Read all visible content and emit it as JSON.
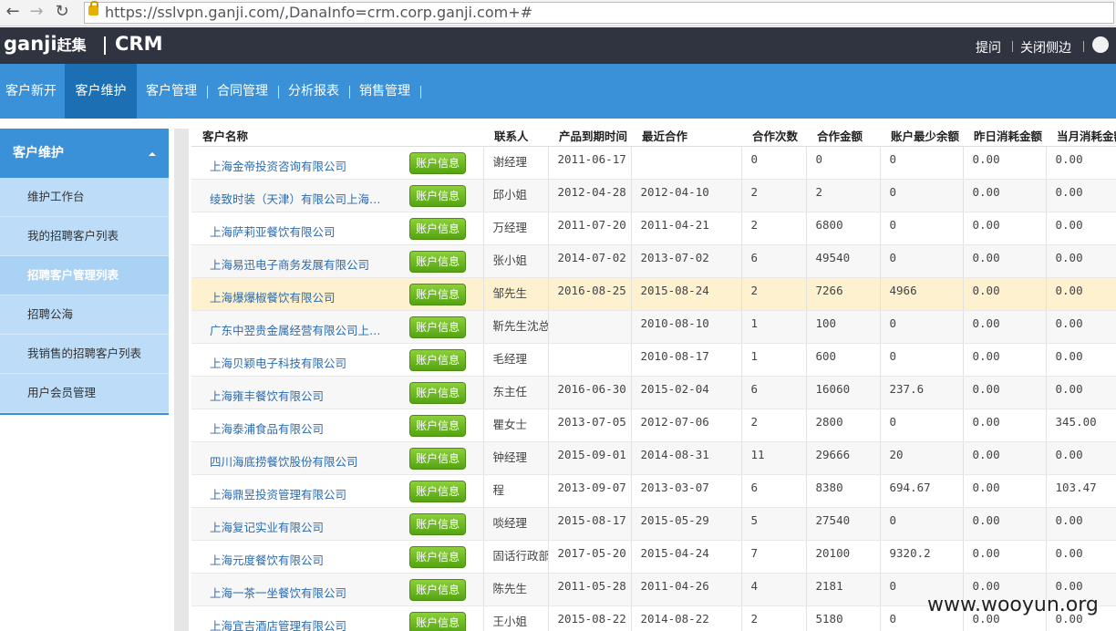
{
  "browser": {
    "url": "https://sslvpn.ganji.com/,DanaInfo=crm.corp.ganji.com+#"
  },
  "header": {
    "logo_en": "ganji",
    "logo_cn": "赶集",
    "app_name": "CRM",
    "links": [
      "提问",
      "关闭侧边"
    ]
  },
  "nav": {
    "tabs": [
      "客户新开",
      "客户维护",
      "客户管理",
      "合同管理",
      "分析报表",
      "销售管理"
    ],
    "active": 1
  },
  "sidebar": {
    "title": "客户维护",
    "items": [
      "维护工作台",
      "我的招聘客户列表",
      "招聘客户管理列表",
      "招聘公海",
      "我销售的招聘客户列表",
      "用户会员管理"
    ],
    "active": 2
  },
  "table": {
    "headers": [
      "客户名称",
      "联系人",
      "产品到期时间",
      "最近合作",
      "合作次数",
      "合作金额",
      "账户最少余额",
      "昨日消耗金额",
      "当月消耗金额"
    ],
    "button_label": "账户信息",
    "highlight_row": 4,
    "rows": [
      [
        "上海金帝投资咨询有限公司",
        "谢经理",
        "2011-06-17",
        "",
        "0",
        "0",
        "0",
        "0.00",
        "0.00"
      ],
      [
        "绫致时装（天津）有限公司上海分公司",
        "邱小姐",
        "2012-04-28",
        "2012-04-10",
        "2",
        "2",
        "0",
        "0.00",
        "0.00"
      ],
      [
        "上海萨莉亚餐饮有限公司",
        "万经理",
        "2011-07-20",
        "2011-04-21",
        "2",
        "6800",
        "0",
        "0.00",
        "0.00"
      ],
      [
        "上海易迅电子商务发展有限公司",
        "张小姐",
        "2014-07-02",
        "2013-07-02",
        "6",
        "49540",
        "0",
        "0.00",
        "0.00"
      ],
      [
        "上海爆爆椒餐饮有限公司",
        "邹先生",
        "2016-08-25",
        "2015-08-24",
        "2",
        "7266",
        "4966",
        "0.00",
        "0.00"
      ],
      [
        "广东中翌贵金属经营有限公司上海分公司",
        "靳先生沈总",
        "",
        "2010-08-10",
        "1",
        "100",
        "0",
        "0.00",
        "0.00"
      ],
      [
        "上海贝颖电子科技有限公司",
        "毛经理",
        "",
        "2010-08-17",
        "1",
        "600",
        "0",
        "0.00",
        "0.00"
      ],
      [
        "上海雍丰餐饮有限公司",
        "东主任",
        "2016-06-30",
        "2015-02-04",
        "6",
        "16060",
        "237.6",
        "0.00",
        "0.00"
      ],
      [
        "上海泰浦食品有限公司",
        "瞿女士",
        "2013-07-05",
        "2012-07-06",
        "2",
        "2800",
        "0",
        "0.00",
        "345.00"
      ],
      [
        "四川海底捞餐饮股份有限公司",
        "钟经理",
        "2015-09-01",
        "2014-08-31",
        "11",
        "29666",
        "20",
        "0.00",
        "0.00"
      ],
      [
        "上海鼎昱投资管理有限公司",
        "程",
        "2013-09-07",
        "2013-03-07",
        "6",
        "8380",
        "694.67",
        "0.00",
        "103.47"
      ],
      [
        "上海复记实业有限公司",
        "啖经理",
        "2015-08-17",
        "2015-05-29",
        "5",
        "27540",
        "0",
        "0.00",
        "0.00"
      ],
      [
        "上海元度餐饮有限公司",
        "固话行政部",
        "2017-05-20",
        "2015-04-24",
        "7",
        "20100",
        "9320.2",
        "0.00",
        "0.00"
      ],
      [
        "上海一茶一坐餐饮有限公司",
        "陈先生",
        "2011-05-28",
        "2011-04-26",
        "4",
        "2181",
        "0",
        "0.00",
        "0.00"
      ],
      [
        "上海宜吉酒店管理有限公司",
        "王小姐",
        "2015-08-22",
        "2014-08-22",
        "2",
        "5180",
        "0",
        "0.00",
        "0.00"
      ]
    ]
  },
  "watermark": "www.wooyun.org"
}
